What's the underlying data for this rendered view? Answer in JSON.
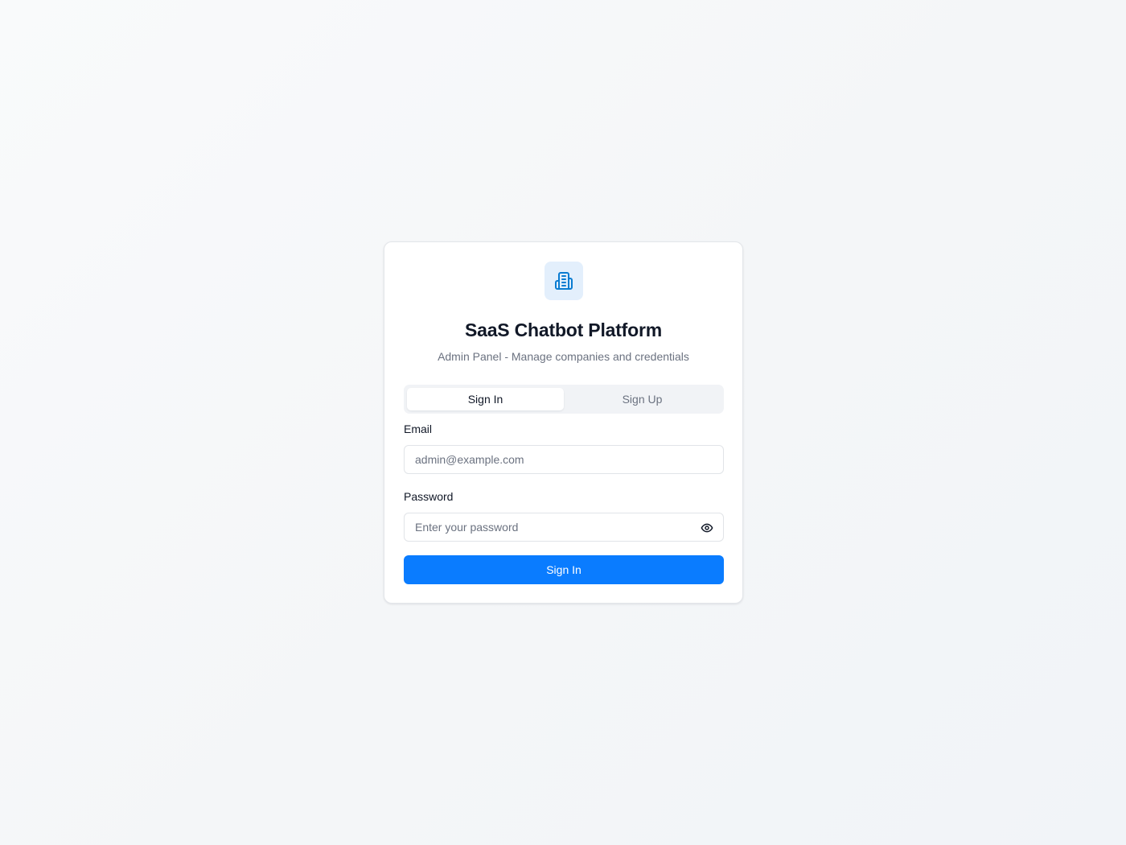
{
  "app": {
    "title": "SaaS Chatbot Platform",
    "subtitle": "Admin Panel - Manage companies and credentials",
    "logo_icon": "building-icon"
  },
  "tabs": [
    {
      "label": "Sign In",
      "active": true
    },
    {
      "label": "Sign Up",
      "active": false
    }
  ],
  "form": {
    "email": {
      "label": "Email",
      "value": "",
      "placeholder": "admin@example.com"
    },
    "password": {
      "label": "Password",
      "value": "",
      "placeholder": "Enter your password",
      "toggle_icon": "eye-icon"
    },
    "submit_label": "Sign In"
  },
  "colors": {
    "accent": "#0a7cff",
    "logo_bg": "#e3effc",
    "logo_fg": "#0a7cd1",
    "text_primary": "#111827",
    "text_muted": "#6b7280"
  }
}
